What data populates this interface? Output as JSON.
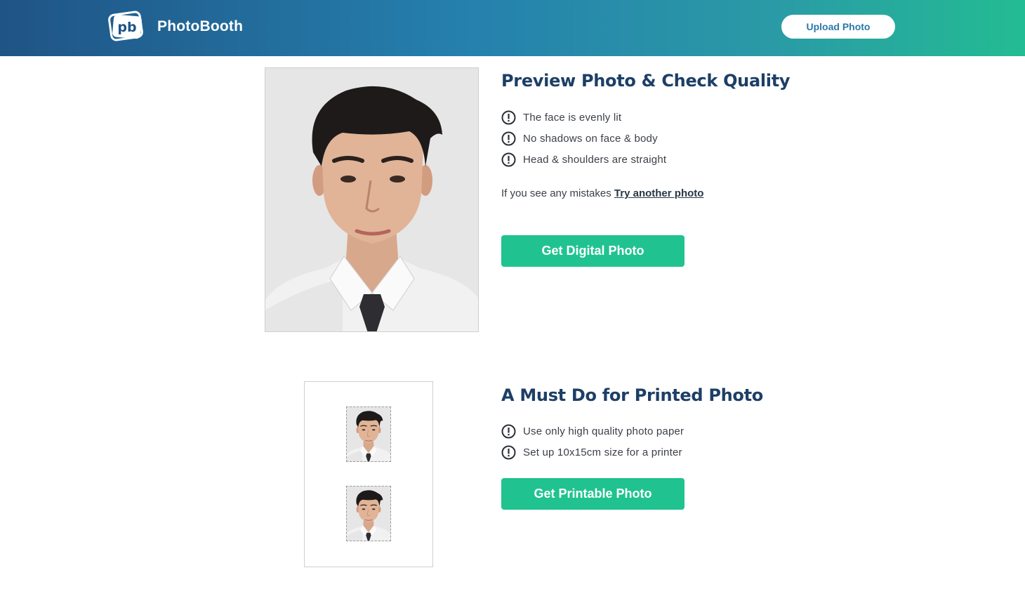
{
  "header": {
    "brand": "PhotoBooth",
    "logo_icon": "pb-logo-icon",
    "upload_label": "Upload Photo"
  },
  "preview": {
    "title": "Preview Photo & Check Quality",
    "checks": [
      "The face is evenly lit",
      "No shadows on face & body",
      "Head & shoulders are straight"
    ],
    "mistake_text": "If you see any mistakes",
    "mistake_link": "Try another photo",
    "button_label": "Get Digital Photo",
    "photo_icon": "passport-portrait-image"
  },
  "printed": {
    "title": "A Must Do for Printed Photo",
    "checks": [
      "Use only high quality photo paper",
      "Set up 10x15cm size for a printer"
    ],
    "button_label": "Get Printable Photo"
  },
  "colors": {
    "header_start": "#1f5486",
    "header_end": "#23bc93",
    "accent_green": "#20c38f",
    "title_blue": "#1d3f66"
  }
}
